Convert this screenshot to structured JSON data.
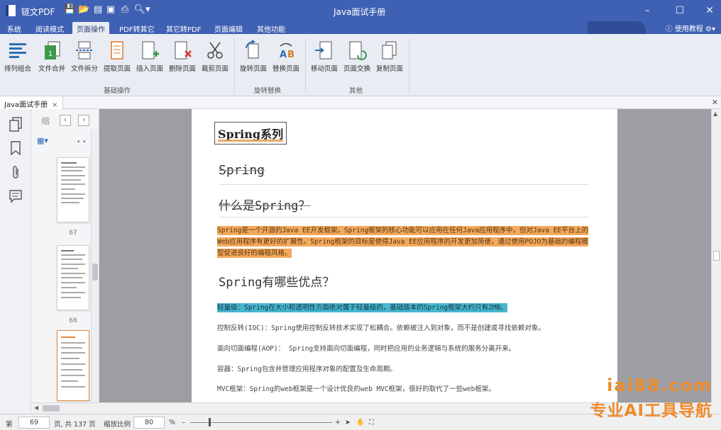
{
  "app": {
    "name": "链文PDF",
    "doc_title": "Java面试手册"
  },
  "menu": {
    "tabs": [
      "系统",
      "阅读模式",
      "页面操作",
      "PDF转其它",
      "其它转PDF",
      "页面编辑",
      "其他功能"
    ],
    "active": "页面操作",
    "help": "使用教程"
  },
  "ribbon": {
    "groups": {
      "basic": "基础操作",
      "rotate": "旋转替换",
      "other": "其他"
    },
    "buttons": {
      "sort_merge": "排列组合",
      "file_merge": "文件合并",
      "file_split": "文件拆分",
      "extract": "提取页面",
      "insert": "插入页面",
      "delete": "删除页面",
      "crop": "裁剪页面",
      "rotate": "旋转页面",
      "replace": "替换页面",
      "move": "移动页面",
      "swap": "页面交换",
      "copy": "复制页面"
    }
  },
  "doc_tab": {
    "label": "Java面试手册",
    "close": "×"
  },
  "thumbnails": {
    "header": "缩",
    "pages": [
      "67",
      "68"
    ]
  },
  "page": {
    "section_title": "Spring系列",
    "heading_spring": "Spring",
    "q1": "什么是Spring？",
    "p1": "Spring是一个开源的Java EE开发框架。Spring框架的核心功能可以应用在任何Java应用程序中，但对Java EE平台上的Web应用程序有更好的扩展性。Spring框架的目标是使得Java EE应用程序的开发更加简便，通过使用POJO为基础的编程模型促进良好的编程风格。",
    "q2": "Spring有哪些优点？",
    "adv_lightweight": "轻量级：Spring在大小和透明性方面绝对属于轻量级的，基础版本的Spring框架大约只有2MB。",
    "adv_ioc": "控制反转(IOC)：Spring使用控制反转技术实现了松耦合。依赖被注入到对象，而不是创建或寻找依赖对象。",
    "adv_aop": "面向切面编程(AOP)：  Spring支持面向切面编程，同时把应用的业务逻辑与系统的服务分离开来。",
    "adv_container": "容器：Spring包含并管理应用程序对象的配置及生命周期。",
    "adv_mvc": "MVC框架：Spring的web框架是一个设计优良的web MVC框架，很好的取代了一些web框架。"
  },
  "status": {
    "page_prefix": "第",
    "current_page": "69",
    "page_suffix": "页, 共 137 页",
    "zoom_label": "缩放比例",
    "zoom_value": "80",
    "zoom_unit": "%"
  },
  "watermark": {
    "line1": "iai88.com",
    "line2": "专业AI工具导航"
  },
  "colors": {
    "titlebar": "#3f61b3",
    "ribbon": "#e9ecf3",
    "highlight_orange": "#f4a95a",
    "highlight_blue": "#47b6cf",
    "watermark": "#ef8a2c"
  }
}
